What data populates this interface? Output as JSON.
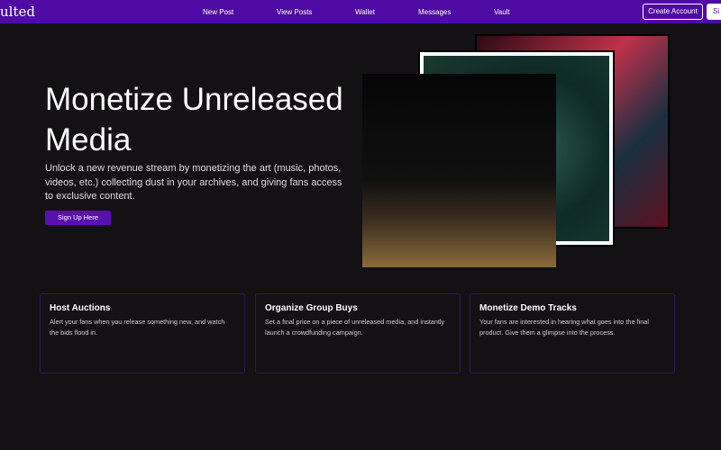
{
  "nav": {
    "logo": "ulted",
    "links": [
      "New Post",
      "View Posts",
      "Wallet",
      "Messages",
      "Vault"
    ],
    "create_account": "Create Account",
    "sign_in": "Si"
  },
  "hero": {
    "title": "Monetize Unreleased Media",
    "subtitle": "Unlock a new revenue stream by monetizing the art (music, photos, videos, etc.) collecting dust in your archives, and giving fans access to exclusive content.",
    "cta": "Sign Up Here"
  },
  "features": [
    {
      "title": "Host Auctions",
      "text": "Alert your fans when you release something new, and watch the bids flood in."
    },
    {
      "title": "Organize Group Buys",
      "text": "Set a final price on a piece of unreleased media, and instantly launch a crowdfunding campaign."
    },
    {
      "title": "Monetize Demo Tracks",
      "text": "Your fans are interested in hearing what goes into the final product. Give them a glimpse into the process."
    }
  ],
  "colors": {
    "nav": "#4e0aa3",
    "background": "#141115",
    "card_border": "#2c1a55"
  }
}
